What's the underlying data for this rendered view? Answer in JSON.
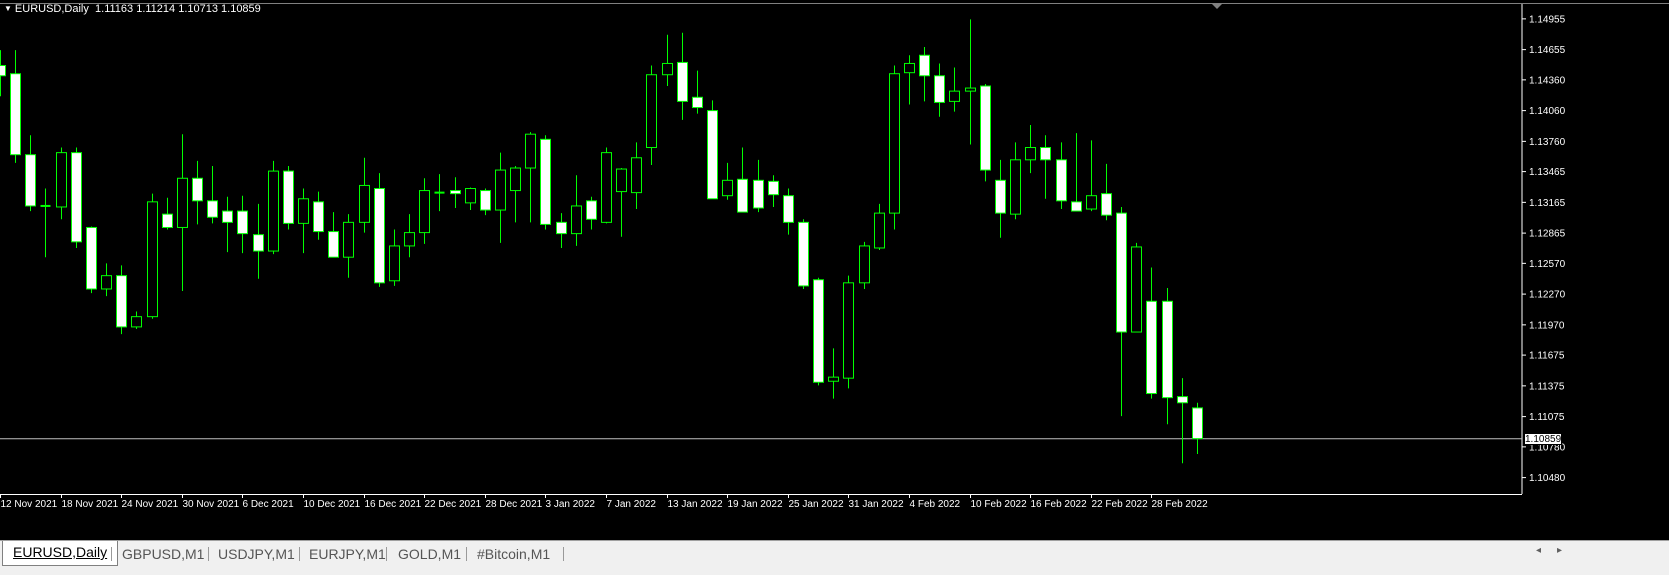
{
  "chart_title": {
    "symbol": "EURUSD,Daily",
    "ohlc": "1.11163 1.11214 1.10713 1.10859"
  },
  "current_price": "1.10859",
  "colors": {
    "background": "#000000",
    "bull_body": "#000000",
    "bear_body": "#ffffff",
    "wick": "#00ff00",
    "axis_text": "#ffffff",
    "price_line": "#c0c0c0"
  },
  "tabs": [
    {
      "label": "EURUSD,Daily",
      "active": true
    },
    {
      "label": "GBPUSD,M1",
      "active": false
    },
    {
      "label": "USDJPY,M1",
      "active": false
    },
    {
      "label": "EURJPY,M1",
      "active": false
    },
    {
      "label": "GOLD,M1",
      "active": false
    },
    {
      "label": "#Bitcoin,M1",
      "active": false
    }
  ],
  "chart_data": {
    "type": "candlestick",
    "ylim": [
      1.1032,
      1.151
    ],
    "y_ticks": [
      "1.14955",
      "1.14655",
      "1.14360",
      "1.14060",
      "1.13760",
      "1.13465",
      "1.13165",
      "1.12865",
      "1.12570",
      "1.12270",
      "1.11970",
      "1.11675",
      "1.11375",
      "1.11075",
      "1.10780",
      "1.10480"
    ],
    "x_ticks": [
      {
        "label": "12 Nov 2021",
        "index": 0
      },
      {
        "label": "18 Nov 2021",
        "index": 4
      },
      {
        "label": "24 Nov 2021",
        "index": 8
      },
      {
        "label": "30 Nov 2021",
        "index": 12
      },
      {
        "label": "6 Dec 2021",
        "index": 16
      },
      {
        "label": "10 Dec 2021",
        "index": 20
      },
      {
        "label": "16 Dec 2021",
        "index": 24
      },
      {
        "label": "22 Dec 2021",
        "index": 28
      },
      {
        "label": "28 Dec 2021",
        "index": 32
      },
      {
        "label": "3 Jan 2022",
        "index": 36
      },
      {
        "label": "7 Jan 2022",
        "index": 40
      },
      {
        "label": "13 Jan 2022",
        "index": 44
      },
      {
        "label": "19 Jan 2022",
        "index": 48
      },
      {
        "label": "25 Jan 2022",
        "index": 52
      },
      {
        "label": "31 Jan 2022",
        "index": 56
      },
      {
        "label": "4 Feb 2022",
        "index": 60
      },
      {
        "label": "10 Feb 2022",
        "index": 64
      },
      {
        "label": "16 Feb 2022",
        "index": 68
      },
      {
        "label": "22 Feb 2022",
        "index": 72
      },
      {
        "label": "28 Feb 2022",
        "index": 76
      }
    ],
    "candles": [
      {
        "o": 1.145,
        "h": 1.1465,
        "l": 1.142,
        "c": 1.144
      },
      {
        "o": 1.1442,
        "h": 1.1465,
        "l": 1.1355,
        "c": 1.1363
      },
      {
        "o": 1.1363,
        "h": 1.1382,
        "l": 1.1308,
        "c": 1.1313
      },
      {
        "o": 1.1313,
        "h": 1.133,
        "l": 1.1263,
        "c": 1.1313
      },
      {
        "o": 1.1312,
        "h": 1.137,
        "l": 1.13,
        "c": 1.1365
      },
      {
        "o": 1.1365,
        "h": 1.137,
        "l": 1.1272,
        "c": 1.1278
      },
      {
        "o": 1.1292,
        "h": 1.1293,
        "l": 1.1228,
        "c": 1.1232
      },
      {
        "o": 1.1232,
        "h": 1.1257,
        "l": 1.1225,
        "c": 1.1245
      },
      {
        "o": 1.1245,
        "h": 1.1255,
        "l": 1.1188,
        "c": 1.1195
      },
      {
        "o": 1.1195,
        "h": 1.121,
        "l": 1.1193,
        "c": 1.1205
      },
      {
        "o": 1.1205,
        "h": 1.1325,
        "l": 1.1203,
        "c": 1.1317
      },
      {
        "o": 1.1305,
        "h": 1.1321,
        "l": 1.129,
        "c": 1.1292
      },
      {
        "o": 1.1292,
        "h": 1.1383,
        "l": 1.123,
        "c": 1.134
      },
      {
        "o": 1.134,
        "h": 1.1357,
        "l": 1.1295,
        "c": 1.1318
      },
      {
        "o": 1.1318,
        "h": 1.1352,
        "l": 1.1296,
        "c": 1.1302
      },
      {
        "o": 1.1308,
        "h": 1.1322,
        "l": 1.1268,
        "c": 1.1297
      },
      {
        "o": 1.1308,
        "h": 1.1323,
        "l": 1.1267,
        "c": 1.1286
      },
      {
        "o": 1.1285,
        "h": 1.1315,
        "l": 1.1242,
        "c": 1.1269
      },
      {
        "o": 1.1269,
        "h": 1.1357,
        "l": 1.1266,
        "c": 1.1347
      },
      {
        "o": 1.1347,
        "h": 1.1352,
        "l": 1.129,
        "c": 1.1296
      },
      {
        "o": 1.1296,
        "h": 1.133,
        "l": 1.1267,
        "c": 1.132
      },
      {
        "o": 1.1317,
        "h": 1.1327,
        "l": 1.128,
        "c": 1.1288
      },
      {
        "o": 1.1288,
        "h": 1.1307,
        "l": 1.1266,
        "c": 1.1263
      },
      {
        "o": 1.1263,
        "h": 1.1305,
        "l": 1.1243,
        "c": 1.1297
      },
      {
        "o": 1.1297,
        "h": 1.136,
        "l": 1.1287,
        "c": 1.1333
      },
      {
        "o": 1.133,
        "h": 1.1345,
        "l": 1.1234,
        "c": 1.1238
      },
      {
        "o": 1.124,
        "h": 1.129,
        "l": 1.1235,
        "c": 1.1274
      },
      {
        "o": 1.1274,
        "h": 1.1305,
        "l": 1.1263,
        "c": 1.1287
      },
      {
        "o": 1.1287,
        "h": 1.134,
        "l": 1.1276,
        "c": 1.1328
      },
      {
        "o": 1.1326,
        "h": 1.1344,
        "l": 1.1308,
        "c": 1.1326
      },
      {
        "o": 1.1328,
        "h": 1.1341,
        "l": 1.1311,
        "c": 1.1325
      },
      {
        "o": 1.1316,
        "h": 1.1331,
        "l": 1.1309,
        "c": 1.133
      },
      {
        "o": 1.1328,
        "h": 1.133,
        "l": 1.1304,
        "c": 1.1309
      },
      {
        "o": 1.1309,
        "h": 1.1365,
        "l": 1.1277,
        "c": 1.1348
      },
      {
        "o": 1.1328,
        "h": 1.1352,
        "l": 1.1297,
        "c": 1.135
      },
      {
        "o": 1.135,
        "h": 1.1385,
        "l": 1.1297,
        "c": 1.1383
      },
      {
        "o": 1.1378,
        "h": 1.1382,
        "l": 1.129,
        "c": 1.1295
      },
      {
        "o": 1.1297,
        "h": 1.1306,
        "l": 1.1272,
        "c": 1.1286
      },
      {
        "o": 1.1286,
        "h": 1.1343,
        "l": 1.1274,
        "c": 1.1313
      },
      {
        "o": 1.1318,
        "h": 1.1322,
        "l": 1.129,
        "c": 1.13
      },
      {
        "o": 1.1297,
        "h": 1.137,
        "l": 1.1296,
        "c": 1.1365
      },
      {
        "o": 1.1327,
        "h": 1.135,
        "l": 1.1283,
        "c": 1.1349
      },
      {
        "o": 1.1326,
        "h": 1.1375,
        "l": 1.131,
        "c": 1.136
      },
      {
        "o": 1.137,
        "h": 1.145,
        "l": 1.1353,
        "c": 1.1441
      },
      {
        "o": 1.1441,
        "h": 1.148,
        "l": 1.143,
        "c": 1.1452
      },
      {
        "o": 1.1453,
        "h": 1.1482,
        "l": 1.1397,
        "c": 1.1415
      },
      {
        "o": 1.1419,
        "h": 1.1445,
        "l": 1.1403,
        "c": 1.1409
      },
      {
        "o": 1.1406,
        "h": 1.1416,
        "l": 1.133,
        "c": 1.132
      },
      {
        "o": 1.1323,
        "h": 1.1355,
        "l": 1.1319,
        "c": 1.1338
      },
      {
        "o": 1.1339,
        "h": 1.137,
        "l": 1.1308,
        "c": 1.1307
      },
      {
        "o": 1.1338,
        "h": 1.1358,
        "l": 1.1307,
        "c": 1.1311
      },
      {
        "o": 1.1337,
        "h": 1.1343,
        "l": 1.1312,
        "c": 1.1324
      },
      {
        "o": 1.1323,
        "h": 1.133,
        "l": 1.1285,
        "c": 1.1297
      },
      {
        "o": 1.1297,
        "h": 1.13,
        "l": 1.1232,
        "c": 1.1235
      },
      {
        "o": 1.1241,
        "h": 1.1243,
        "l": 1.1138,
        "c": 1.1141
      },
      {
        "o": 1.1142,
        "h": 1.1174,
        "l": 1.1125,
        "c": 1.1146
      },
      {
        "o": 1.1145,
        "h": 1.1245,
        "l": 1.1135,
        "c": 1.1238
      },
      {
        "o": 1.1238,
        "h": 1.1278,
        "l": 1.1232,
        "c": 1.1274
      },
      {
        "o": 1.1272,
        "h": 1.1315,
        "l": 1.127,
        "c": 1.1306
      },
      {
        "o": 1.1306,
        "h": 1.145,
        "l": 1.129,
        "c": 1.1442
      },
      {
        "o": 1.1443,
        "h": 1.146,
        "l": 1.1412,
        "c": 1.1452
      },
      {
        "o": 1.146,
        "h": 1.1468,
        "l": 1.1415,
        "c": 1.144
      },
      {
        "o": 1.144,
        "h": 1.1452,
        "l": 1.14,
        "c": 1.1414
      },
      {
        "o": 1.1415,
        "h": 1.1448,
        "l": 1.1405,
        "c": 1.1425
      },
      {
        "o": 1.1425,
        "h": 1.1495,
        "l": 1.1373,
        "c": 1.1428
      },
      {
        "o": 1.143,
        "h": 1.1432,
        "l": 1.1337,
        "c": 1.1348
      },
      {
        "o": 1.1338,
        "h": 1.1358,
        "l": 1.1282,
        "c": 1.1306
      },
      {
        "o": 1.1305,
        "h": 1.1375,
        "l": 1.13,
        "c": 1.1358
      },
      {
        "o": 1.1358,
        "h": 1.1392,
        "l": 1.1345,
        "c": 1.137
      },
      {
        "o": 1.137,
        "h": 1.1382,
        "l": 1.132,
        "c": 1.1358
      },
      {
        "o": 1.1358,
        "h": 1.1375,
        "l": 1.131,
        "c": 1.1318
      },
      {
        "o": 1.1317,
        "h": 1.1384,
        "l": 1.1309,
        "c": 1.1308
      },
      {
        "o": 1.131,
        "h": 1.1377,
        "l": 1.1308,
        "c": 1.1323
      },
      {
        "o": 1.1325,
        "h": 1.1354,
        "l": 1.1299,
        "c": 1.1304
      },
      {
        "o": 1.1306,
        "h": 1.1312,
        "l": 1.1108,
        "c": 1.119
      },
      {
        "o": 1.119,
        "h": 1.1277,
        "l": 1.119,
        "c": 1.1273
      },
      {
        "o": 1.122,
        "h": 1.1253,
        "l": 1.1125,
        "c": 1.113
      },
      {
        "o": 1.122,
        "h": 1.1233,
        "l": 1.11,
        "c": 1.1126
      },
      {
        "o": 1.1127,
        "h": 1.1145,
        "l": 1.1062,
        "c": 1.1121
      },
      {
        "o": 1.1116,
        "h": 1.1121,
        "l": 1.1071,
        "c": 1.1086
      }
    ]
  }
}
